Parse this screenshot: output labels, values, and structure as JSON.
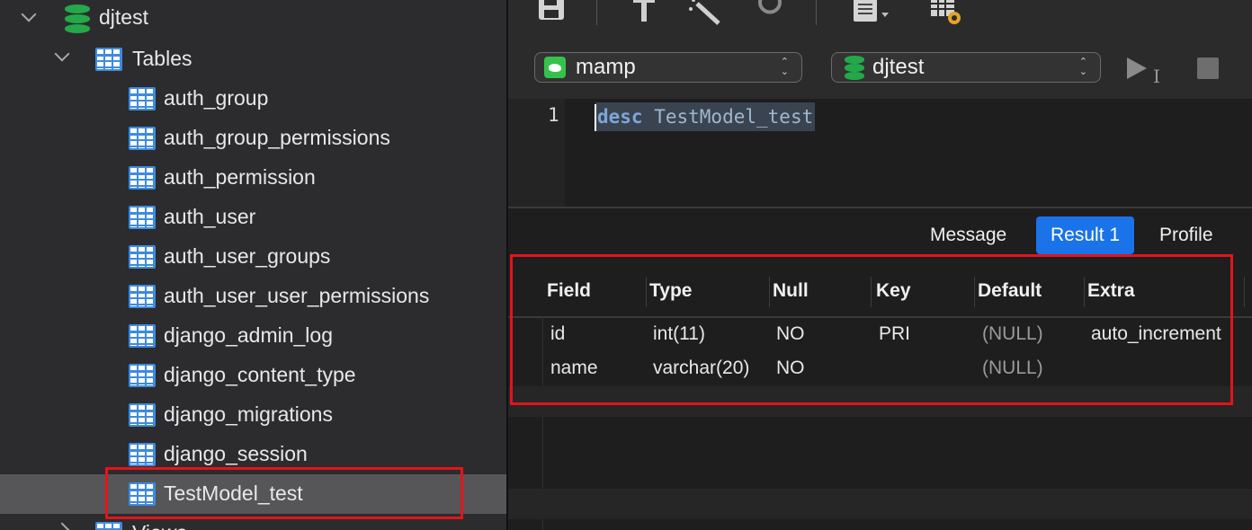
{
  "sidebar": {
    "database": "djtest",
    "tables_group": "Tables",
    "tables": [
      "auth_group",
      "auth_group_permissions",
      "auth_permission",
      "auth_user",
      "auth_user_groups",
      "auth_user_user_permissions",
      "django_admin_log",
      "django_content_type",
      "django_migrations",
      "django_session",
      "TestModel_test"
    ],
    "selected_table": "TestModel_test",
    "views_group": "Views"
  },
  "toolbar": {
    "connection": "mamp",
    "database": "djtest",
    "icons": [
      "save-icon",
      "format-icon",
      "magic-wand-icon",
      "undo-icon",
      "document-icon",
      "table-settings-icon",
      "run-icon",
      "stop-icon"
    ]
  },
  "editor": {
    "line_number": "1",
    "keyword": "desc",
    "rest": " TestModel_test"
  },
  "tabs": [
    "Message",
    "Result 1",
    "Profile"
  ],
  "active_tab": "Result 1",
  "result": {
    "columns": [
      "Field",
      "Type",
      "Null",
      "Key",
      "Default",
      "Extra"
    ],
    "rows": [
      [
        "id",
        "int(11)",
        "NO",
        "PRI",
        "(NULL)",
        "auto_increment"
      ],
      [
        "name",
        "varchar(20)",
        "NO",
        "",
        "(NULL)",
        ""
      ]
    ]
  },
  "colors": {
    "accent": "#1a73e8",
    "annotation": "#e3141b",
    "db_green": "#23a84a",
    "table_blue": "#3d8be0"
  }
}
